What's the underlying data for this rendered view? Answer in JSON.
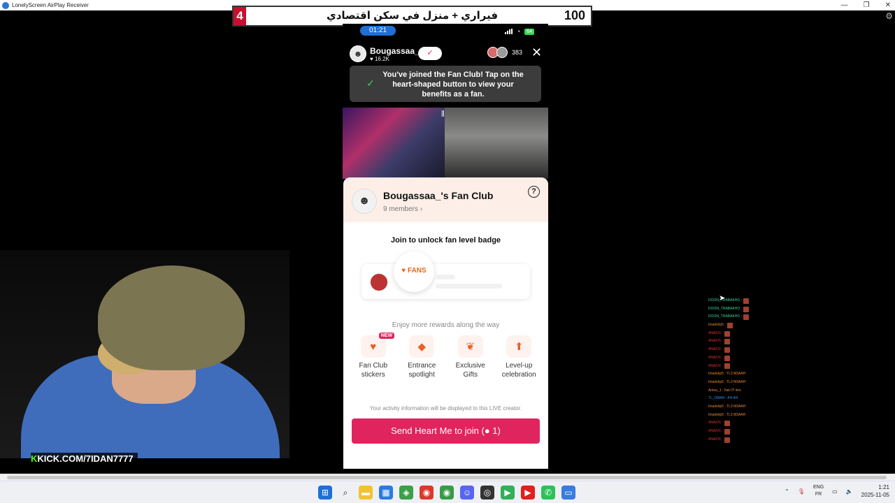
{
  "window": {
    "title": "LonelyScreen AirPlay Receiver",
    "minimize": "—",
    "restore": "❐",
    "close": "✕"
  },
  "banner": {
    "left_number": "4",
    "text": "فيراري + منزل في سكن اقتصادي",
    "right_number": "100"
  },
  "phone": {
    "time": "01:21",
    "battery": "64",
    "host": {
      "name": "Bougassaa_",
      "likes": "16.2K"
    },
    "viewer_count": "383",
    "toast": "You've joined the Fan Club! Tap on the heart-shaped button to view your benefits as a fan.",
    "fan_club": {
      "title": "Bougassaa_'s Fan Club",
      "members": "9 members ›",
      "unlock_text": "Join to unlock fan level badge",
      "badge_label": "FANS",
      "rewards_heading": "Enjoy more rewards along the way",
      "rewards": [
        {
          "icon": "sticker-icon",
          "label_line1": "Fan Club",
          "label_line2": "stickers",
          "tag": "NEW",
          "glyph": "♥"
        },
        {
          "icon": "entrance-icon",
          "label_line1": "Entrance",
          "label_line2": "spotlight",
          "tag": "",
          "glyph": "◆"
        },
        {
          "icon": "gift-icon",
          "label_line1": "Exclusive",
          "label_line2": "Gifts",
          "tag": "",
          "glyph": "❦"
        },
        {
          "icon": "level-up-icon",
          "label_line1": "Level-up",
          "label_line2": "celebration",
          "tag": "",
          "glyph": "⬆"
        }
      ],
      "disclaimer": "Your activity information will be displayed to this LIVE creator.",
      "send_button": "Send Heart Me to join (● 1)"
    }
  },
  "webcam": {
    "overlay_url": "KICK.COM/7IDAN7777",
    "overlay_k": "K"
  },
  "chat": [
    {
      "user": "DOON_TRABAKHO :",
      "color": "#3fd0a0",
      "emote": true
    },
    {
      "user": "DOON_TRABAKHO :",
      "color": "#3fd0a0",
      "emote": true
    },
    {
      "user": "DOON_TRABAKHO :",
      "color": "#3fd0a0",
      "emote": true
    },
    {
      "user": "Imadshp5 :",
      "color": "#e88a2a",
      "emote": true
    },
    {
      "user": "ANAZIX :",
      "color": "#e03030",
      "emote": true
    },
    {
      "user": "ANAZIX :",
      "color": "#e03030",
      "emote": true
    },
    {
      "user": "ANAZIX :",
      "color": "#e03030",
      "emote": true
    },
    {
      "user": "ANAZIX :",
      "color": "#e03030",
      "emote": true
    },
    {
      "user": "ANAZIX :",
      "color": "#e03030",
      "emote": true
    },
    {
      "user": "Imadshp5 : TL3 M3AAH",
      "color": "#e88a2a",
      "emote": false
    },
    {
      "user": "Imadshp5 : TL3 M3AAH",
      "color": "#e88a2a",
      "emote": false
    },
    {
      "user": "Antoa_1 : 5ak l7l lino",
      "color": "#e88a2a",
      "emote": false
    },
    {
      "user": "7L_OMAR : AH AH",
      "color": "#3a8fe0",
      "emote": false
    },
    {
      "user": "Imadshp5 : TL3 M3AAH",
      "color": "#e88a2a",
      "emote": false
    },
    {
      "user": "Imadshp5 : TL3 M3AAH",
      "color": "#e88a2a",
      "emote": false
    },
    {
      "user": "ANAZIX :",
      "color": "#e03030",
      "emote": true
    },
    {
      "user": "ANAZIX :",
      "color": "#e03030",
      "emote": true
    },
    {
      "user": "ANAZIX :",
      "color": "#e03030",
      "emote": true
    }
  ],
  "taskbar": {
    "icons": [
      {
        "name": "start-icon",
        "bg": "#1e6fd9",
        "glyph": "⊞"
      },
      {
        "name": "search-icon",
        "bg": "transparent",
        "glyph": "⌕"
      },
      {
        "name": "file-explorer-icon",
        "bg": "#f2c230",
        "glyph": "▬"
      },
      {
        "name": "store-icon",
        "bg": "#2a7be0",
        "glyph": "▦"
      },
      {
        "name": "layers-app-icon",
        "bg": "#3aa04a",
        "glyph": "◈"
      },
      {
        "name": "chrome-icon",
        "bg": "#d9392b",
        "glyph": "◉"
      },
      {
        "name": "chrome-profile-icon",
        "bg": "#3a9a4a",
        "glyph": "◉"
      },
      {
        "name": "discord-icon",
        "bg": "#5865f2",
        "glyph": "☺"
      },
      {
        "name": "obs-icon",
        "bg": "#333",
        "glyph": "◎"
      },
      {
        "name": "play-app-icon",
        "bg": "#2fb05a",
        "glyph": "▶"
      },
      {
        "name": "youtube-icon",
        "bg": "#e02020",
        "glyph": "▶"
      },
      {
        "name": "whatsapp-icon",
        "bg": "#2cc25a",
        "glyph": "✆"
      },
      {
        "name": "lonelyscreen-icon",
        "bg": "#3a7be0",
        "glyph": "▭"
      }
    ],
    "lang_top": "ENG",
    "lang_bottom": "FR",
    "time": "1:21",
    "date": "2025-11-05"
  }
}
